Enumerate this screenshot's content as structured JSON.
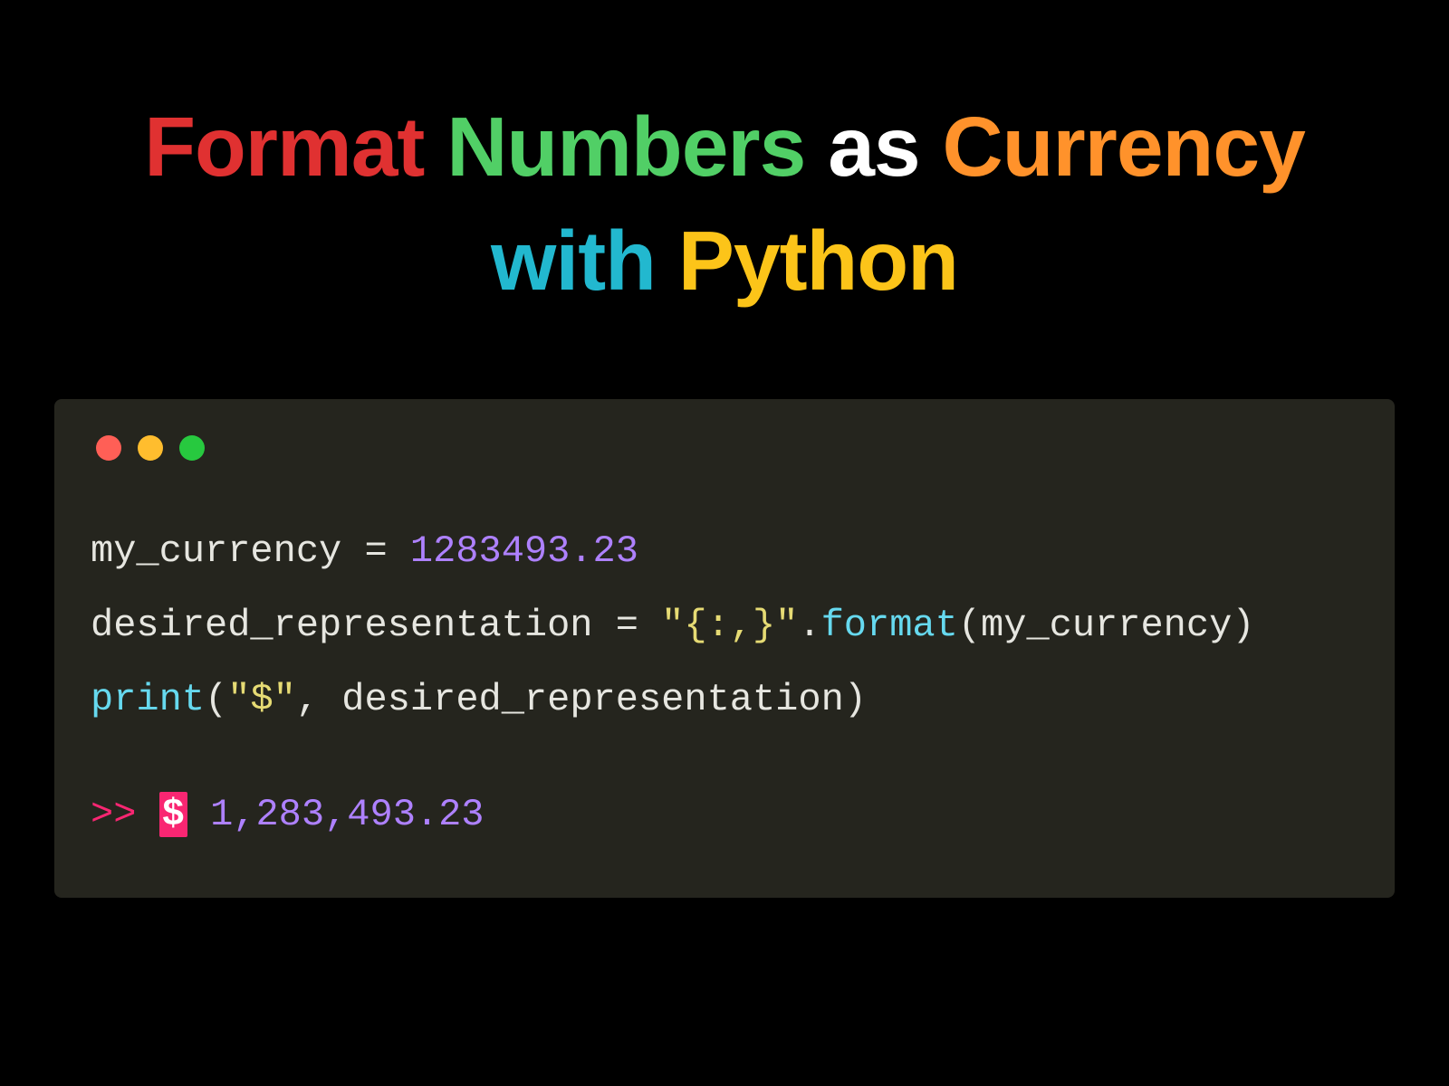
{
  "title": {
    "w1": "Format",
    "w2": "Numbers",
    "w3": "as",
    "w4": "Currency",
    "w5": "with",
    "w6": "Python"
  },
  "code": {
    "line1_var": "my_currency",
    "line1_assign": " = ",
    "line1_value": "1283493.23",
    "line2_var": "desired_representation",
    "line2_assign": " = ",
    "line2_str": "\"{:,}\"",
    "line2_dot": ".",
    "line2_method": "format",
    "line2_paren_open": "(",
    "line2_arg": "my_currency",
    "line2_paren_close": ")",
    "line3_func": "print",
    "line3_paren_open": "(",
    "line3_str": "\"$\"",
    "line3_comma": ", ",
    "line3_arg": "desired_representation",
    "line3_paren_close": ")",
    "out_prompt": ">> ",
    "out_cursor": "$",
    "out_space": " ",
    "out_value": "1,283,493.23"
  }
}
